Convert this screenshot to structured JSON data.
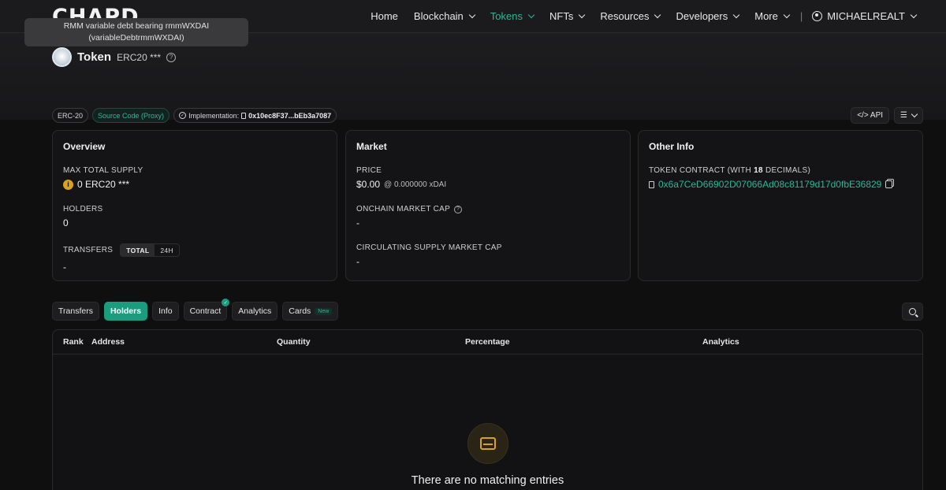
{
  "header": {
    "logo_text": "CHAPD",
    "nav": [
      {
        "label": "Home",
        "dropdown": false,
        "active": false
      },
      {
        "label": "Blockchain",
        "dropdown": true,
        "active": false
      },
      {
        "label": "Tokens",
        "dropdown": true,
        "active": true
      },
      {
        "label": "NFTs",
        "dropdown": true,
        "active": false
      },
      {
        "label": "Resources",
        "dropdown": true,
        "active": false
      },
      {
        "label": "Developers",
        "dropdown": true,
        "active": false
      },
      {
        "label": "More",
        "dropdown": true,
        "active": false
      }
    ],
    "separator": "|",
    "user": "MICHAELREALT"
  },
  "tooltip": {
    "line1": "RMM variable debt bearing rmmWXDAI",
    "line2": "(variableDebtrmmWXDAI)"
  },
  "token": {
    "title": "Token",
    "subtitle": "ERC20 ***",
    "help": "?"
  },
  "badges": {
    "standard": "ERC-20",
    "source": "Source Code (Proxy)",
    "implementation_label": "Implementation:",
    "implementation_value": "0x10ec8F37...bEb3a7087"
  },
  "tools": {
    "api": "</> API",
    "menu_icon": "list-icon"
  },
  "overview": {
    "title": "Overview",
    "max_supply_label": "MAX TOTAL SUPPLY",
    "max_supply_value": "0 ERC20 ***",
    "coin_glyph": "i",
    "holders_label": "HOLDERS",
    "holders_value": "0",
    "transfers_label": "TRANSFERS",
    "transfers_toggle": [
      "TOTAL",
      "24H"
    ],
    "transfers_value": "-"
  },
  "market": {
    "title": "Market",
    "price_label": "PRICE",
    "price_value": "$0.00",
    "price_sub": "@ 0.000000 xDAI",
    "onchain_cap_label": "ONCHAIN MARKET CAP",
    "onchain_cap_value": "-",
    "circ_cap_label": "CIRCULATING SUPPLY MARKET CAP",
    "circ_cap_value": "-"
  },
  "other_info": {
    "title": "Other Info",
    "contract_label_prefix": "TOKEN CONTRACT (WITH ",
    "contract_decimals": "18",
    "contract_label_suffix": " DECIMALS)",
    "contract_address": "0x6a7CeD66902D07066Ad08c81179d17d0fbE36829"
  },
  "tabs": [
    {
      "label": "Transfers",
      "active": false
    },
    {
      "label": "Holders",
      "active": true
    },
    {
      "label": "Info",
      "active": false
    },
    {
      "label": "Contract",
      "active": false,
      "verified": true
    },
    {
      "label": "Analytics",
      "active": false
    },
    {
      "label": "Cards",
      "active": false,
      "tag": "New"
    }
  ],
  "table": {
    "columns": [
      "Rank",
      "Address",
      "Quantity",
      "Percentage",
      "Analytics"
    ],
    "empty_message": "There are no matching entries"
  },
  "colors": {
    "accent": "#2fb696",
    "active_tab": "#1a9c7e",
    "coin": "#d9a21c",
    "background": "#0f0f0f"
  }
}
